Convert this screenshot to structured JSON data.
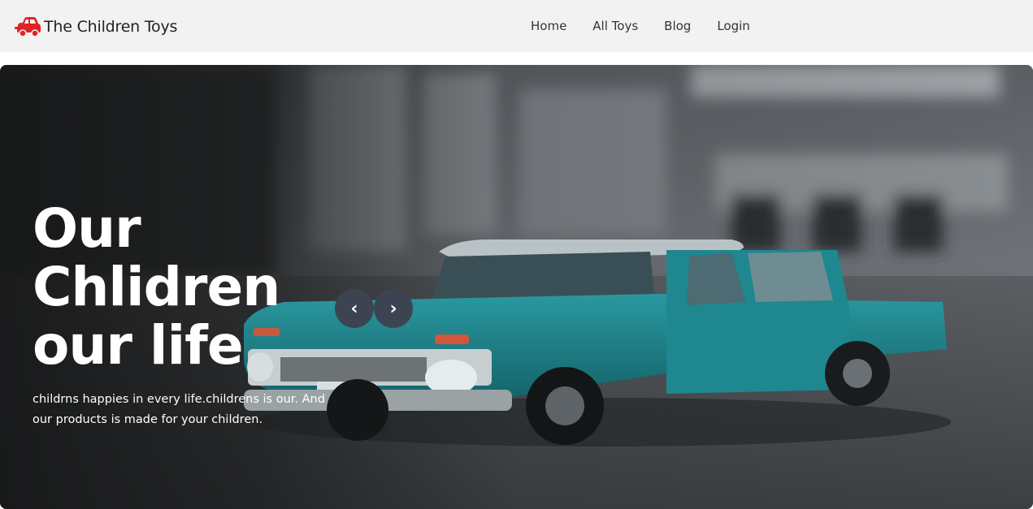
{
  "brand": {
    "name": "The Children Toys",
    "icon": "toy-car-icon",
    "icon_color": "#e02424"
  },
  "nav": {
    "items": [
      {
        "label": "Home"
      },
      {
        "label": "All Toys"
      },
      {
        "label": "Blog"
      },
      {
        "label": "Login"
      }
    ]
  },
  "hero": {
    "title": "Our\nChlidren\nour life",
    "text": "childrns happies in every life.childrens is our. And our products is made for your children.",
    "prev_label": "‹",
    "next_label": "›",
    "image": "blurred-street-with-teal-chevrolet-toy-pickup"
  },
  "colors": {
    "navbar_bg": "#f2f2f2",
    "arrow_bg": "#3d4451",
    "car_teal": "#1c7e86"
  }
}
